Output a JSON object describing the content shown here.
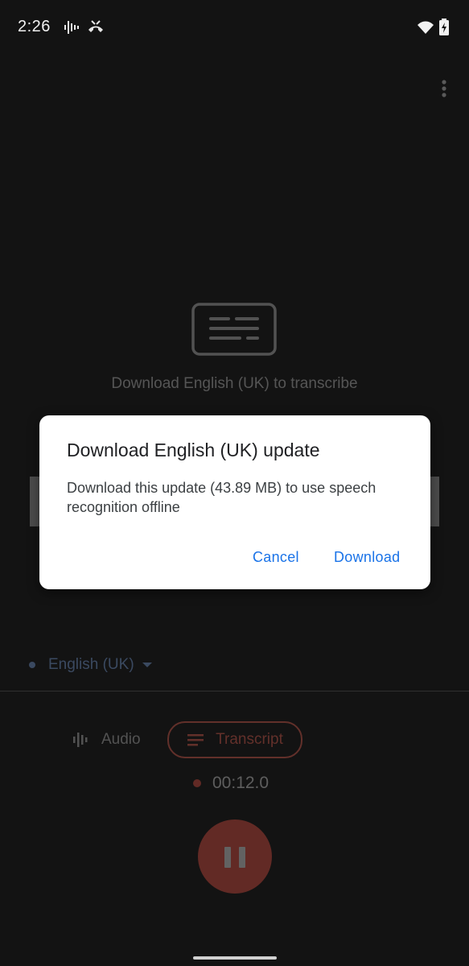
{
  "status_bar": {
    "time": "2:26",
    "icons": [
      "voice-waveform-icon",
      "phone-call-icon",
      "wifi-icon",
      "battery-charging-icon"
    ]
  },
  "header": {
    "overflow_icon": "more-vert-icon"
  },
  "background": {
    "illustration_icon": "transcript-icon",
    "message": "Download English (UK) to transcribe",
    "language": "English (UK)",
    "tabs": {
      "audio": "Audio",
      "transcript": "Transcript"
    },
    "timer": "00:12.0",
    "pause_icon": "pause-icon"
  },
  "dialog": {
    "title": "Download English (UK) update",
    "body": "Download this update (43.89 MB) to use speech recognition offline",
    "cancel_label": "Cancel",
    "download_label": "Download"
  },
  "colors": {
    "accent_red": "#ff5a4a",
    "accent_blue": "#1a73e8",
    "language_blue": "#8ab4f8"
  }
}
